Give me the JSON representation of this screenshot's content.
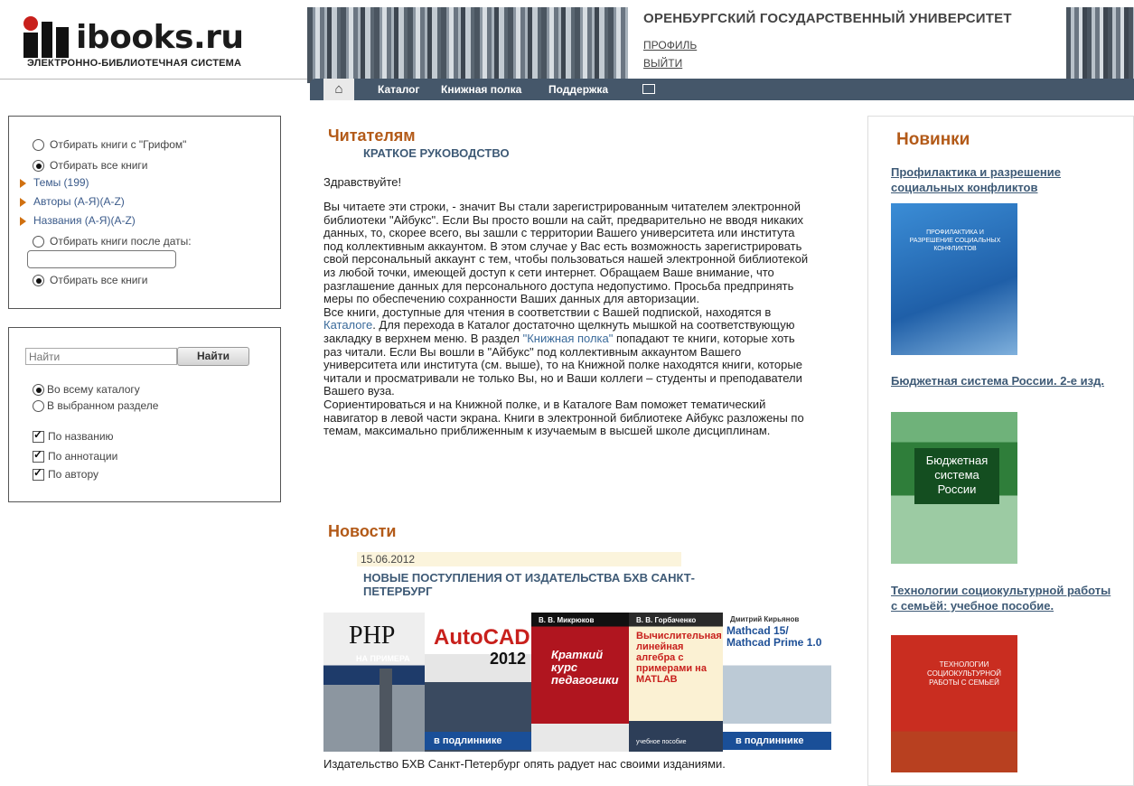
{
  "header": {
    "logo_text": "ibooks.ru",
    "logo_sub": "ЭЛЕКТРОННО-БИБЛИОТЕЧНАЯ СИСТЕМА",
    "university": "ОРЕНБУРГСКИЙ ГОСУДАРСТВЕННЫЙ УНИВЕРСИТЕТ",
    "profile": "ПРОФИЛЬ",
    "logout": "ВЫЙТИ"
  },
  "nav": {
    "home_icon": "home-icon",
    "items": [
      "Каталог",
      "Книжная полка",
      "Поддержка"
    ],
    "mail_icon": "mail-icon"
  },
  "filter": {
    "grif": "Отбирать книги с \"Грифом\"",
    "all_books": "Отбирать все книги",
    "themes": "Темы (199)",
    "authors": "Авторы (А-Я)(A-Z)",
    "titles": "Названия (А-Я)(A-Z)",
    "after_date": "Отбирать книги после даты:",
    "date_value": "",
    "all_books2": "Отбирать все книги"
  },
  "search": {
    "placeholder": "Найти",
    "button": "Найти",
    "scope_all": "Во всему каталогу",
    "scope_section": "В выбранном разделе",
    "by_title": "По названию",
    "by_annotation": "По аннотации",
    "by_author": "По автору"
  },
  "main": {
    "readers_title": "Читателям",
    "guide_title": "КРАТКОЕ РУКОВОДСТВО",
    "greeting": "Здравствуйте!",
    "p1": "Вы читаете эти строки, - значит Вы стали зарегистрированным читателем электронной библиотеки \"Айбукс\". Если Вы просто вошли на сайт, предварительно не вводя никаких данных, то, скорее всего, вы зашли с территории Вашего университета или института под коллективным аккаунтом. В этом случае у Вас есть возможность зарегистрировать свой персональный аккаунт с тем, чтобы пользоваться нашей электронной библиотекой из любой точки, имеющей доступ к сети интернет. Обращаем Ваше внимание, что разглашение данных для персонального доступа недопустимо. Просьба предпринять меры по обеспечению сохранности Ваших данных для авторизации.",
    "p2_a": "Все книги, доступные для чтения в соответствии с Вашей подпиской, находятся в ",
    "p2_link1": "Каталоге",
    "p2_b": ". Для перехода в Каталог достаточно щелкнуть мышкой на соответствующую закладку в верхнем меню. В раздел ",
    "p2_link2": "\"Книжная полка\"",
    "p2_c": " попадают те книги, которые хоть раз читали. Если Вы вошли в \"Айбукс\" под коллективным аккаунтом Вашего университета или института (см. выше), то на Книжной полке находятся книги, которые читали и просматривали не только Вы, но и Ваши коллеги – студенты и преподаватели Вашего вуза.",
    "p3": "Сориентироваться и на Книжной полке, и в Каталоге Вам поможет тематический навигатор в левой части экрана. Книги в электронной библиотеке Айбукс разложены по темам, максимально приближенным к изучаемым в высшей школе дисциплинам.",
    "news_title": "Новости",
    "news_date": "15.06.2012",
    "news_headline": "НОВЫЕ ПОСТУПЛЕНИЯ ОТ ИЗДАТЕЛЬСТВА БХВ САНКТ-ПЕТЕРБУРГ",
    "covers": {
      "php": "PHP",
      "php_sub": "НА ПРИМЕРА",
      "autocad": "AutoCAD",
      "autocad_year": "2012",
      "autocad_band": "в подлиннике",
      "ped": "Краткий курс педагогики",
      "ped_author": "В. В. Микрюков",
      "matlab": "Вычислительная линейная алгебра с примерами на MATLAB",
      "matlab_author": "В. В. Горбаченко",
      "matlab_band": "учебное пособие",
      "mathcad": "Mathcad 15/ Mathcad Prime 1.0",
      "mathcad_author": "Дмитрий Кирьянов",
      "mathcad_band": "в подлиннике"
    },
    "publisher_text": "Издательство БХВ Санкт-Петербург опять радует нас своими изданиями."
  },
  "new_books": {
    "title": "Новинки",
    "items": [
      {
        "title": "Профилактика и разрешение социальных конфликтов",
        "cover_text": "ПРОФИЛАКТИКА И РАЗРЕШЕНИЕ СОЦИАЛЬНЫХ КОНФЛИКТОВ"
      },
      {
        "title": "Бюджетная система России. 2-е изд.",
        "cover_text": "Бюджетная система России"
      },
      {
        "title": "Технологии социокультурной работы с семьёй: учебное пособие.",
        "cover_text": "ТЕХНОЛОГИИ СОЦИОКУЛЬТУРНОЙ РАБОТЫ С СЕМЬЕЙ"
      }
    ]
  },
  "colors": {
    "accent": "#b35a18",
    "nav": "#45576a",
    "link": "#3e5a76"
  }
}
